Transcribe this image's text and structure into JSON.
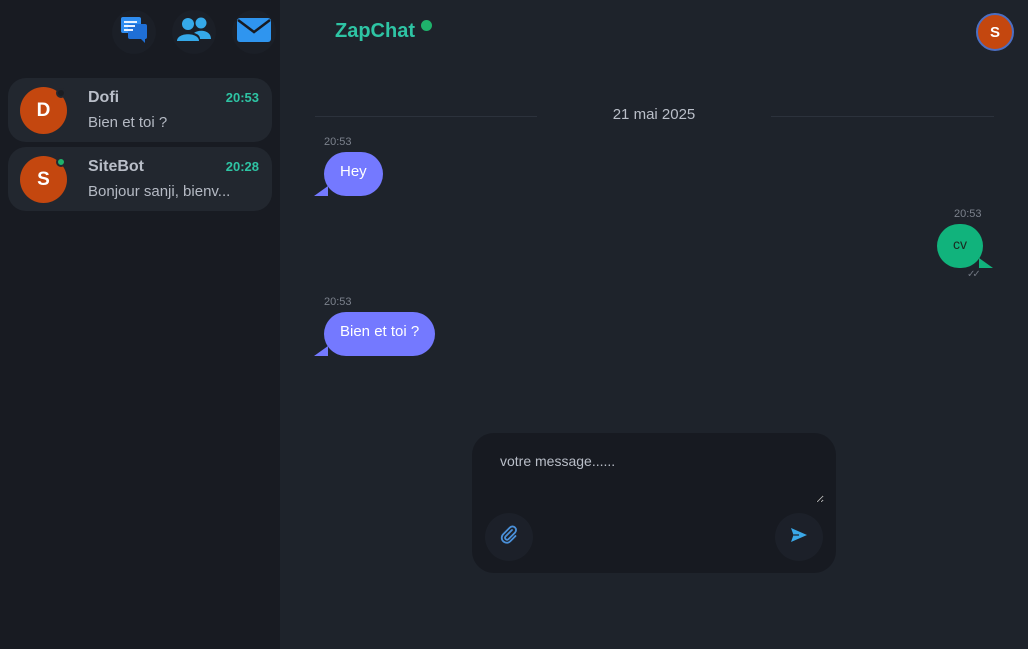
{
  "app": {
    "title": "ZapChat",
    "online_color": "#1fb26b",
    "accent": "#2ec4a4"
  },
  "nav_icons": [
    "chat-bubbles-icon",
    "contacts-icon",
    "mail-icon"
  ],
  "current_user": {
    "initial": "S"
  },
  "conversations": [
    {
      "initial": "D",
      "name": "Dofi",
      "time": "20:53",
      "preview": "Bien et toi ?",
      "status": "offline"
    },
    {
      "initial": "S",
      "name": "SiteBot",
      "time": "20:28",
      "preview": "Bonjour sanji, bienv...",
      "status": "online"
    }
  ],
  "chat": {
    "date": "21 mai 2025",
    "messages": [
      {
        "direction": "in",
        "time": "20:53",
        "text": "Hey"
      },
      {
        "direction": "out",
        "time": "20:53",
        "text": "cv",
        "read_receipt": "✓✓"
      },
      {
        "direction": "in",
        "time": "20:53",
        "text": "Bien et toi ?"
      }
    ]
  },
  "composer": {
    "placeholder": "votre message......",
    "attach_icon": "paperclip-icon",
    "send_icon": "send-icon"
  }
}
